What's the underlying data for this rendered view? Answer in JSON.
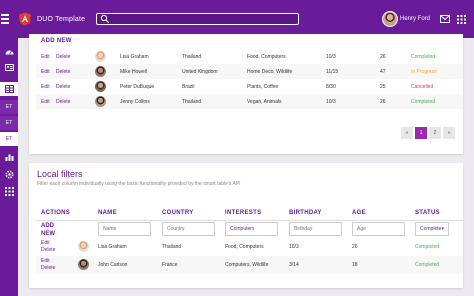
{
  "app": {
    "title": "DUO Template",
    "user_name": "Henry Ford"
  },
  "search": {
    "placeholder": ""
  },
  "sidebar": {
    "items": [
      "",
      "",
      "",
      "ET",
      "ET",
      "ET",
      "",
      "",
      ""
    ]
  },
  "table1": {
    "add_new": "ADD NEW",
    "rows": [
      {
        "edit": "Edit",
        "delete": "Delete",
        "name": "Lisa Graham",
        "country": "Thailand",
        "interests": "Food, Computers",
        "birthday": "10/3",
        "age": "26",
        "status": "Completed",
        "status_color": "#4caf50"
      },
      {
        "edit": "Edit",
        "delete": "Delete",
        "name": "Mike Howell",
        "country": "United Kingdom",
        "interests": "Home Deco, Wildlife",
        "birthday": "11/15",
        "age": "47",
        "status": "In Progress",
        "status_color": "#f9a825"
      },
      {
        "edit": "Edit",
        "delete": "Delete",
        "name": "Peter DuBuque",
        "country": "Brazil",
        "interests": "Plants, Coffee",
        "birthday": "8/30",
        "age": "25",
        "status": "Cancelled",
        "status_color": "#e53935"
      },
      {
        "edit": "Edit",
        "delete": "Delete",
        "name": "Jenny Collins",
        "country": "Thailand",
        "interests": "Vegan, Animals",
        "birthday": "10/3",
        "age": "26",
        "status": "Completed",
        "status_color": "#4caf50"
      }
    ],
    "pager": {
      "prev": "«",
      "pages": [
        "1",
        "2"
      ],
      "next": "»"
    }
  },
  "table2": {
    "title": "Local filters",
    "description": "Filter each column individually using the basic functionality provided by the smart table's API",
    "headers": [
      "ACTIONS",
      "NAME",
      "COUNTRY",
      "INTERESTS",
      "BIRTHDAY",
      "AGE",
      "STATUS"
    ],
    "add_new": "ADD NEW",
    "filters": {
      "name": "Name",
      "country": "Country",
      "interests": "Computers",
      "birthday": "Birthday",
      "age": "Age",
      "status": "Complete"
    },
    "rows": [
      {
        "edit": "Edit",
        "delete": "Delete",
        "name": "Lisa Graham",
        "country": "Thailand",
        "interests": "Food, Computers",
        "birthday": "10/3",
        "age": "26",
        "status": "Completed",
        "status_color": "#4caf50"
      },
      {
        "edit": "Edit",
        "delete": "Delete",
        "name": "John Carlson",
        "country": "France",
        "interests": "Computers, Wildlife",
        "birthday": "3/14",
        "age": "18",
        "status": "Completed",
        "status_color": "#4caf50"
      }
    ]
  }
}
